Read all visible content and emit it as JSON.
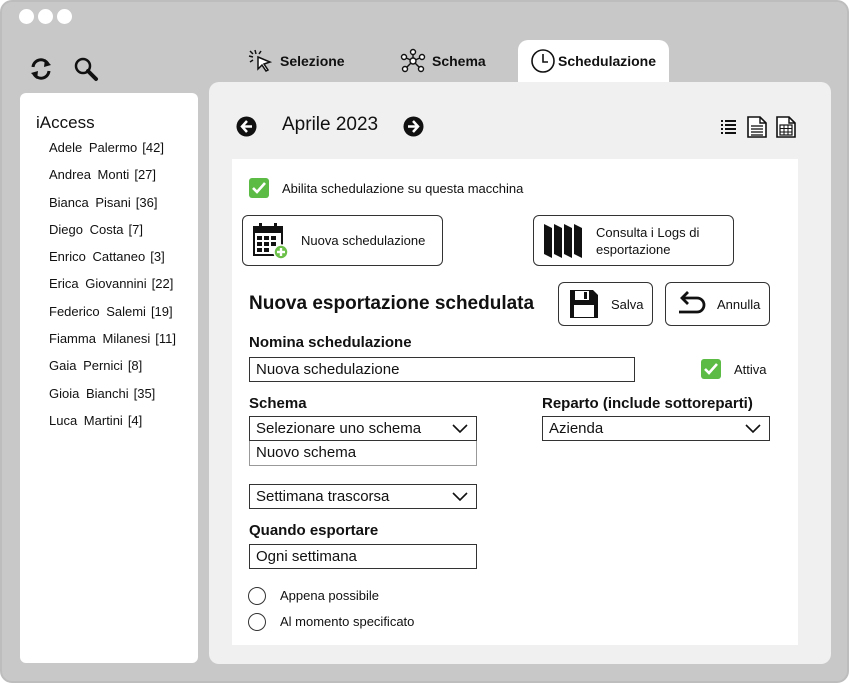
{
  "sidebar": {
    "title": "iAccess",
    "items": [
      {
        "label": "Adele Palermo",
        "count": "[42]"
      },
      {
        "label": "Andrea Monti",
        "count": "[27]"
      },
      {
        "label": "Bianca Pisani",
        "count": "[36]"
      },
      {
        "label": "Diego Costa",
        "count": "[7]"
      },
      {
        "label": "Enrico Cattaneo",
        "count": "[3]"
      },
      {
        "label": "Erica Giovannini",
        "count": "[22]"
      },
      {
        "label": "Federico Salemi",
        "count": "[19]"
      },
      {
        "label": "Fiamma Milanesi",
        "count": "[11]"
      },
      {
        "label": "Gaia Pernici",
        "count": "[8]"
      },
      {
        "label": "Gioia Bianchi",
        "count": "[35]"
      },
      {
        "label": "Luca Martini",
        "count": "[4]"
      }
    ]
  },
  "toolbar": {
    "refresh_icon": "refresh-icon",
    "search_icon": "search-icon"
  },
  "tabs": [
    {
      "label": "Selezione",
      "icon": "cursor-click-icon"
    },
    {
      "label": "Schema",
      "icon": "network-icon"
    },
    {
      "label": "Schedulazione",
      "icon": "clock-icon",
      "active": true
    }
  ],
  "calendar": {
    "month": "Aprile 2023"
  },
  "form": {
    "enable_label": "Abilita schedulazione su questa macchina",
    "new_schedule_button": "Nuova schedulazione",
    "logs_button": "Consulta i Logs di esportazione",
    "section_title": "Nuova esportazione schedulata",
    "save_button": "Salva",
    "cancel_button": "Annulla",
    "name_label": "Nomina schedulazione",
    "name_value": "Nuova schedulazione",
    "active_label": "Attiva",
    "schema_label": "Schema",
    "schema_value": "Selezionare uno schema",
    "schema_option": "Nuovo schema",
    "department_label": "Reparto (include sottoreparti)",
    "department_value": "Azienda",
    "period_value": "Settimana trascorsa",
    "when_label": "Quando esportare",
    "when_value": "Ogni settimana",
    "radio_asap": "Appena possibile",
    "radio_specified": "Al momento specificato"
  },
  "colors": {
    "frame": "#c8c8c8",
    "panel": "#f0f0f0",
    "check": "#5bbb45",
    "accent_icon": "#6cc04a"
  }
}
